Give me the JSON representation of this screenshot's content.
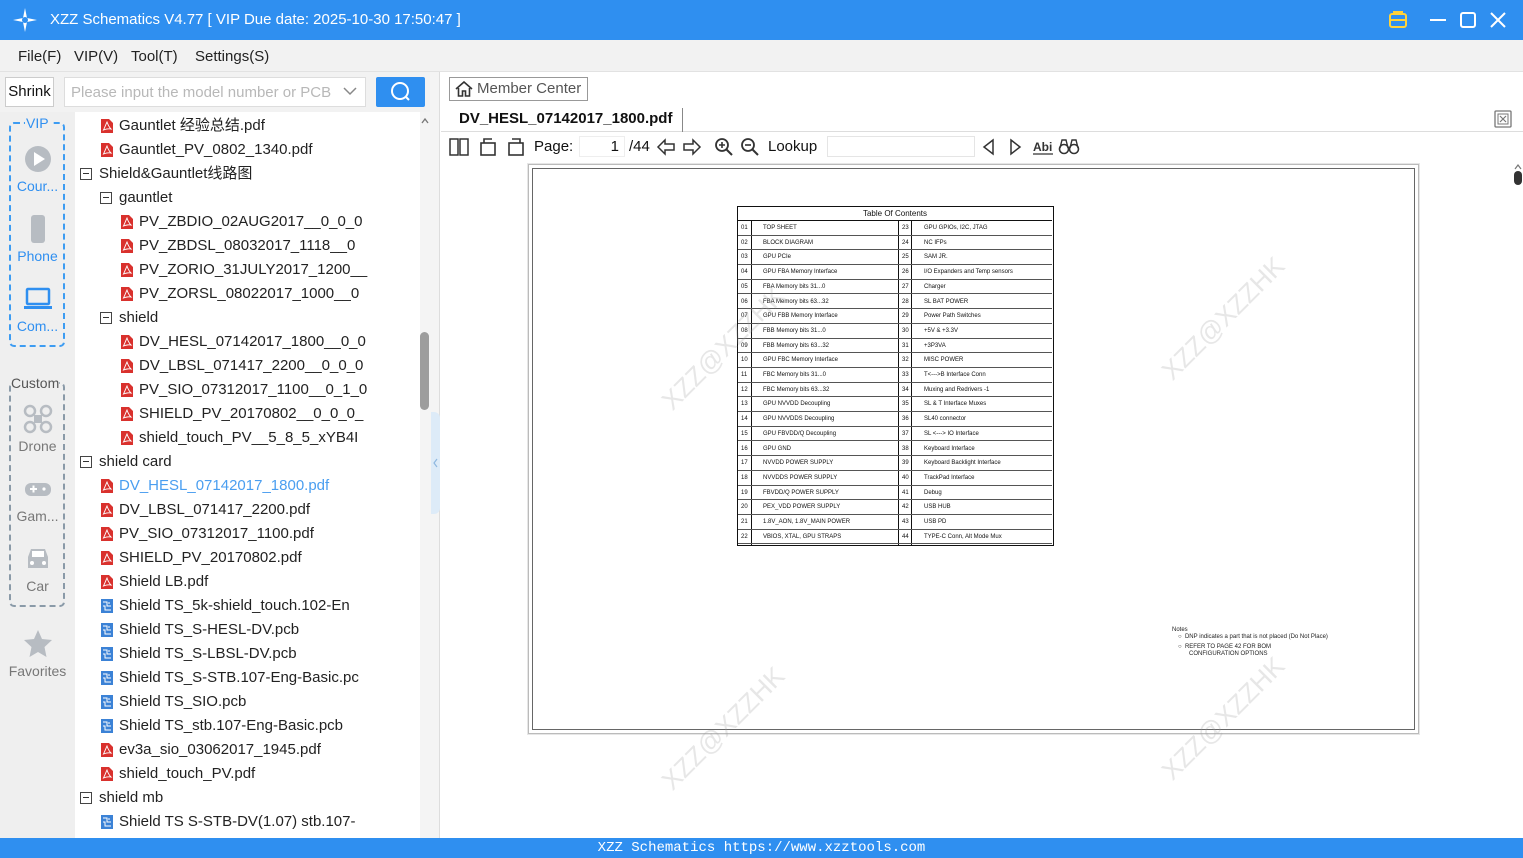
{
  "window": {
    "title": "XZZ Schematics V4.77 [ VIP Due date: 2025-10-30 17:50:47 ]"
  },
  "menu": [
    "File(F)",
    "VIP(V)",
    "Tool(T)",
    "Settings(S)"
  ],
  "toolbar": {
    "shrink_label": "Shrink",
    "search_placeholder": "Please input the model number or PCB"
  },
  "nav": {
    "vip_label": "VIP",
    "vip_items": [
      "Cour...",
      "Phone",
      "Com..."
    ],
    "custom_label": "Custom",
    "custom_items": [
      "Drone",
      "Gam...",
      "Car"
    ],
    "favorites": "Favorites"
  },
  "tree": [
    {
      "label": "Gauntlet 经验总结.pdf",
      "type": "pdf",
      "level": 1
    },
    {
      "label": "Gauntlet_PV_0802_1340.pdf",
      "type": "pdf",
      "level": 1
    },
    {
      "label": "Shield&Gauntlet线路图",
      "type": "folder",
      "level": 0
    },
    {
      "label": "gauntlet",
      "type": "folder",
      "level": 1
    },
    {
      "label": "PV_ZBDIO_02AUG2017__0_0_0",
      "type": "pdf",
      "level": 2
    },
    {
      "label": "PV_ZBDSL_08032017_1118__0",
      "type": "pdf",
      "level": 2
    },
    {
      "label": "PV_ZORIO_31JULY2017_1200__",
      "type": "pdf",
      "level": 2
    },
    {
      "label": "PV_ZORSL_08022017_1000__0",
      "type": "pdf",
      "level": 2
    },
    {
      "label": "shield",
      "type": "folder",
      "level": 1
    },
    {
      "label": "DV_HESL_07142017_1800__0_0",
      "type": "pdf",
      "level": 2
    },
    {
      "label": "DV_LBSL_071417_2200__0_0_0",
      "type": "pdf",
      "level": 2
    },
    {
      "label": "PV_SIO_07312017_1100__0_1_0",
      "type": "pdf",
      "level": 2
    },
    {
      "label": "SHIELD_PV_20170802__0_0_0_",
      "type": "pdf",
      "level": 2
    },
    {
      "label": "shield_touch_PV__5_8_5_xYB4I",
      "type": "pdf",
      "level": 2
    },
    {
      "label": "shield card",
      "type": "folder",
      "level": 0
    },
    {
      "label": "DV_HESL_07142017_1800.pdf",
      "type": "pdf",
      "level": 1,
      "selected": true
    },
    {
      "label": "DV_LBSL_071417_2200.pdf",
      "type": "pdf",
      "level": 1
    },
    {
      "label": "PV_SIO_07312017_1100.pdf",
      "type": "pdf",
      "level": 1
    },
    {
      "label": "SHIELD_PV_20170802.pdf",
      "type": "pdf",
      "level": 1
    },
    {
      "label": "Shield LB.pdf",
      "type": "pdf",
      "level": 1
    },
    {
      "label": "Shield TS_5k-shield_touch.102-En",
      "type": "pcb",
      "level": 1
    },
    {
      "label": "Shield TS_S-HESL-DV.pcb",
      "type": "pcb",
      "level": 1
    },
    {
      "label": "Shield TS_S-LBSL-DV.pcb",
      "type": "pcb",
      "level": 1
    },
    {
      "label": "Shield TS_S-STB.107-Eng-Basic.pc",
      "type": "pcb",
      "level": 1
    },
    {
      "label": "Shield TS_SIO.pcb",
      "type": "pcb",
      "level": 1
    },
    {
      "label": "Shield TS_stb.107-Eng-Basic.pcb",
      "type": "pcb",
      "level": 1
    },
    {
      "label": "ev3a_sio_03062017_1945.pdf",
      "type": "pdf",
      "level": 1
    },
    {
      "label": "shield_touch_PV.pdf",
      "type": "pdf",
      "level": 1
    },
    {
      "label": "shield mb",
      "type": "folder",
      "level": 0
    },
    {
      "label": "Shield TS S-STB-DV(1.07) stb.107-",
      "type": "pcb",
      "level": 1
    }
  ],
  "viewer": {
    "member_center": "Member Center",
    "tab": "DV_HESL_07142017_1800.pdf",
    "page_label": "Page:",
    "page_current": "1",
    "page_total": "/44",
    "lookup_label": "Lookup"
  },
  "document": {
    "toc_title": "Table Of Contents",
    "toc_left": [
      [
        "01",
        "TOP SHEET"
      ],
      [
        "02",
        "BLOCK DIAGRAM"
      ],
      [
        "03",
        "GPU PCIe"
      ],
      [
        "04",
        "GPU FBA Memory Interface"
      ],
      [
        "05",
        "FBA Memory bits 31...0"
      ],
      [
        "06",
        "FBA Memory bits 63...32"
      ],
      [
        "07",
        "GPU FBB Memory Interface"
      ],
      [
        "08",
        "FBB Memory bits 31...0"
      ],
      [
        "09",
        "FBB Memory bits 63...32"
      ],
      [
        "10",
        "GPU FBC Memory Interface"
      ],
      [
        "11",
        "FBC Memory bits 31...0"
      ],
      [
        "12",
        "FBC Memory bits 63...32"
      ],
      [
        "13",
        "GPU NVVDD Decoupling"
      ],
      [
        "14",
        "GPU NVVDDS Decoupling"
      ],
      [
        "15",
        "GPU FBVDD/Q Decoupling"
      ],
      [
        "16",
        "GPU GND"
      ],
      [
        "17",
        "NVVDD POWER SUPPLY"
      ],
      [
        "18",
        "NVVDDS POWER SUPPLY"
      ],
      [
        "19",
        "FBVDD/Q POWER SUPPLY"
      ],
      [
        "20",
        "PEX_VDD POWER SUPPLY"
      ],
      [
        "21",
        "1.8V_AON, 1.8V_MAIN POWER"
      ],
      [
        "22",
        "VBIOS, XTAL, GPU STRAPS"
      ]
    ],
    "toc_right": [
      [
        "23",
        "GPU GPIOs, I2C, JTAG"
      ],
      [
        "24",
        "NC IFPs"
      ],
      [
        "25",
        "SAM JR."
      ],
      [
        "26",
        "I/O Expanders and Temp sensors"
      ],
      [
        "27",
        "Charger"
      ],
      [
        "28",
        "SL BAT POWER"
      ],
      [
        "29",
        "Power Path Switches"
      ],
      [
        "30",
        "+5V & +3.3V"
      ],
      [
        "31",
        "+3P3VA"
      ],
      [
        "32",
        "MISC POWER"
      ],
      [
        "33",
        "T<--->B Interface Conn"
      ],
      [
        "34",
        "Muxing and Redrivers -1"
      ],
      [
        "35",
        "SL & T Interface Muxes"
      ],
      [
        "36",
        "SL40 connector"
      ],
      [
        "37",
        "SL <---> IO Interface"
      ],
      [
        "38",
        "Keyboard Interface"
      ],
      [
        "39",
        "Keyboard Backlight Interface"
      ],
      [
        "40",
        "TrackPad Interface"
      ],
      [
        "41",
        "Debug"
      ],
      [
        "42",
        "USB HUB"
      ],
      [
        "43",
        "USB PD"
      ],
      [
        "44",
        "TYPE-C Conn, Alt Mode Mux"
      ]
    ],
    "notes_title": "Notes",
    "notes": [
      "DNP indicates a part that is not placed (Do Not Place)",
      "REFER TO PAGE 42 FOR BOM",
      "CONFIGURATION OPTIONS"
    ],
    "watermark": "XZZ@XZZHK"
  },
  "status": "XZZ Schematics https://www.xzztools.com",
  "colors": {
    "accent": "#2f8ff0",
    "pdf_red": "#d9312d",
    "pcb_blue": "#3b82d6"
  }
}
